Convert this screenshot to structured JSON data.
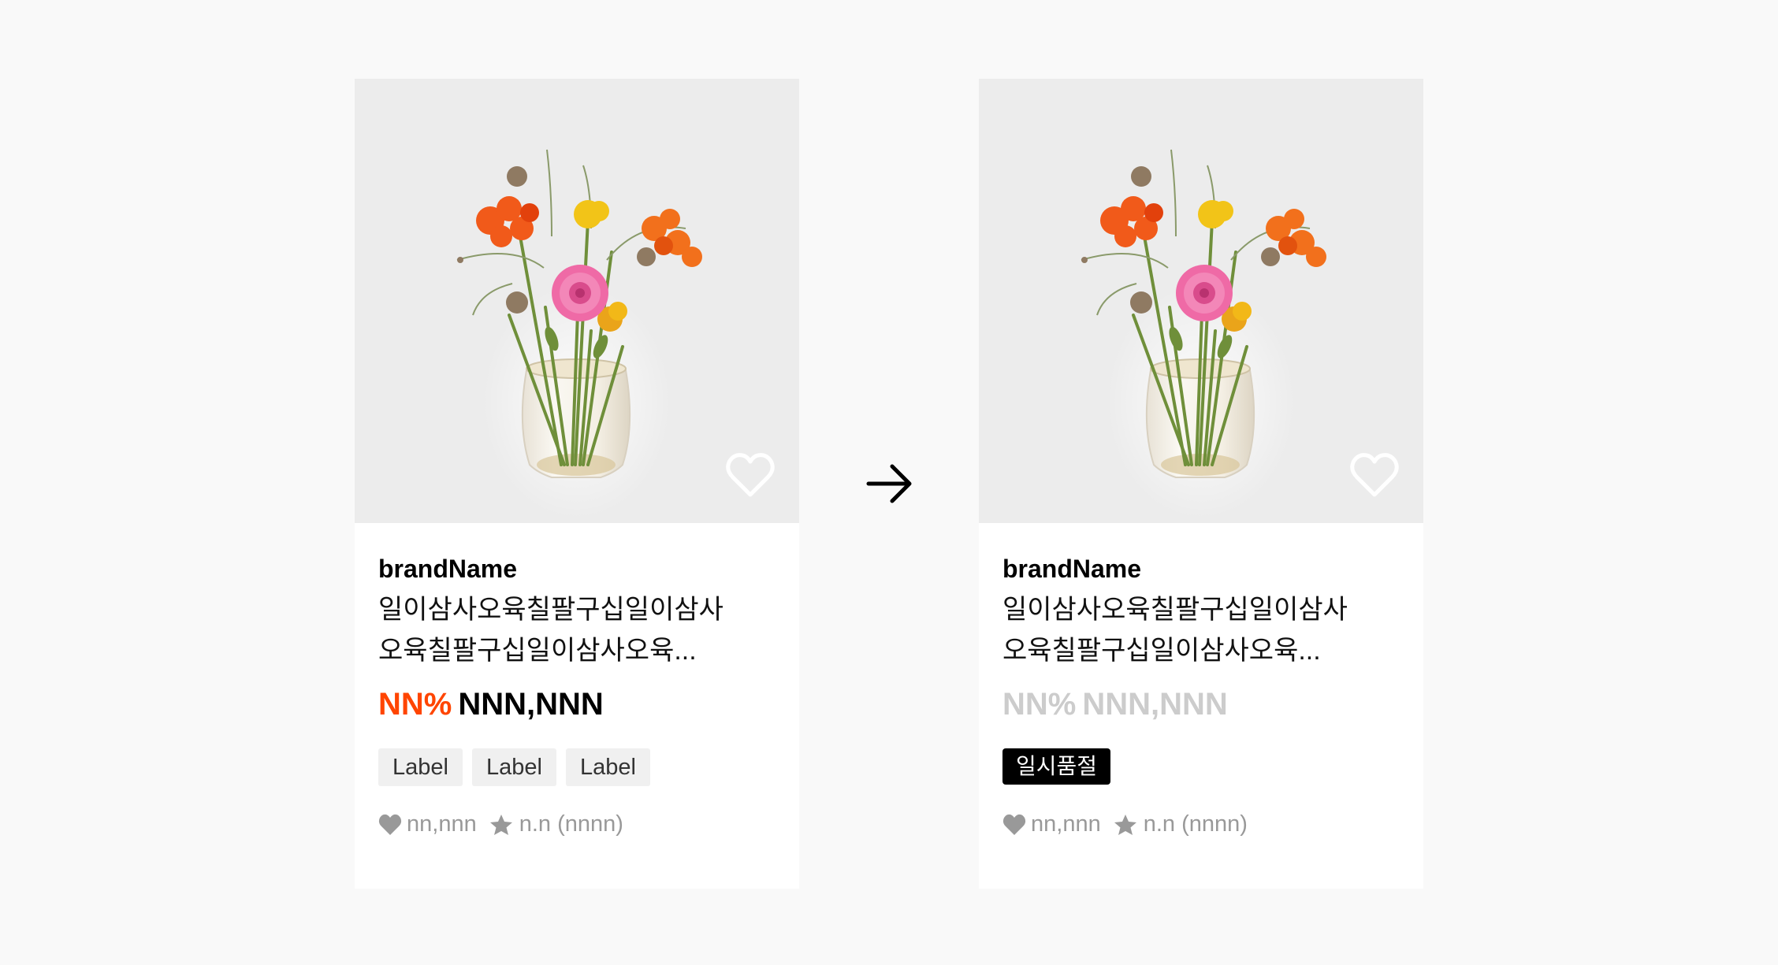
{
  "cards": [
    {
      "state": "default",
      "brand": "brandName",
      "title_line1": "일이삼사오육칠팔구십일이삼사",
      "title_line2": "오육칠팔구십일이삼사오육...",
      "discount": "NN%",
      "price": "NNN,NNN",
      "labels": [
        "Label",
        "Label",
        "Label"
      ],
      "likes": "nn,nnn",
      "rating": "n.n (nnnn)"
    },
    {
      "state": "sold-out",
      "brand": "brandName",
      "title_line1": "일이삼사오육칠팔구십일이삼사",
      "title_line2": "오육칠팔구십일이삼사오육...",
      "discount": "NN%",
      "price": "NNN,NNN",
      "badge": "일시품절",
      "likes": "nn,nnn",
      "rating": "n.n (nnnn)"
    }
  ],
  "icons": {
    "wishlist": "heart-outline-icon",
    "likes": "heart-filled-icon",
    "rating": "star-icon",
    "transition": "arrow-right-icon"
  },
  "colors": {
    "discount": "#ff4500",
    "price": "#000000",
    "disabled_price": "#cccccc",
    "badge_bg": "#000000",
    "label_bg": "#f0f0f0",
    "meta": "#999999",
    "image_bg": "#ececec",
    "page_bg": "#f9f9f9"
  }
}
